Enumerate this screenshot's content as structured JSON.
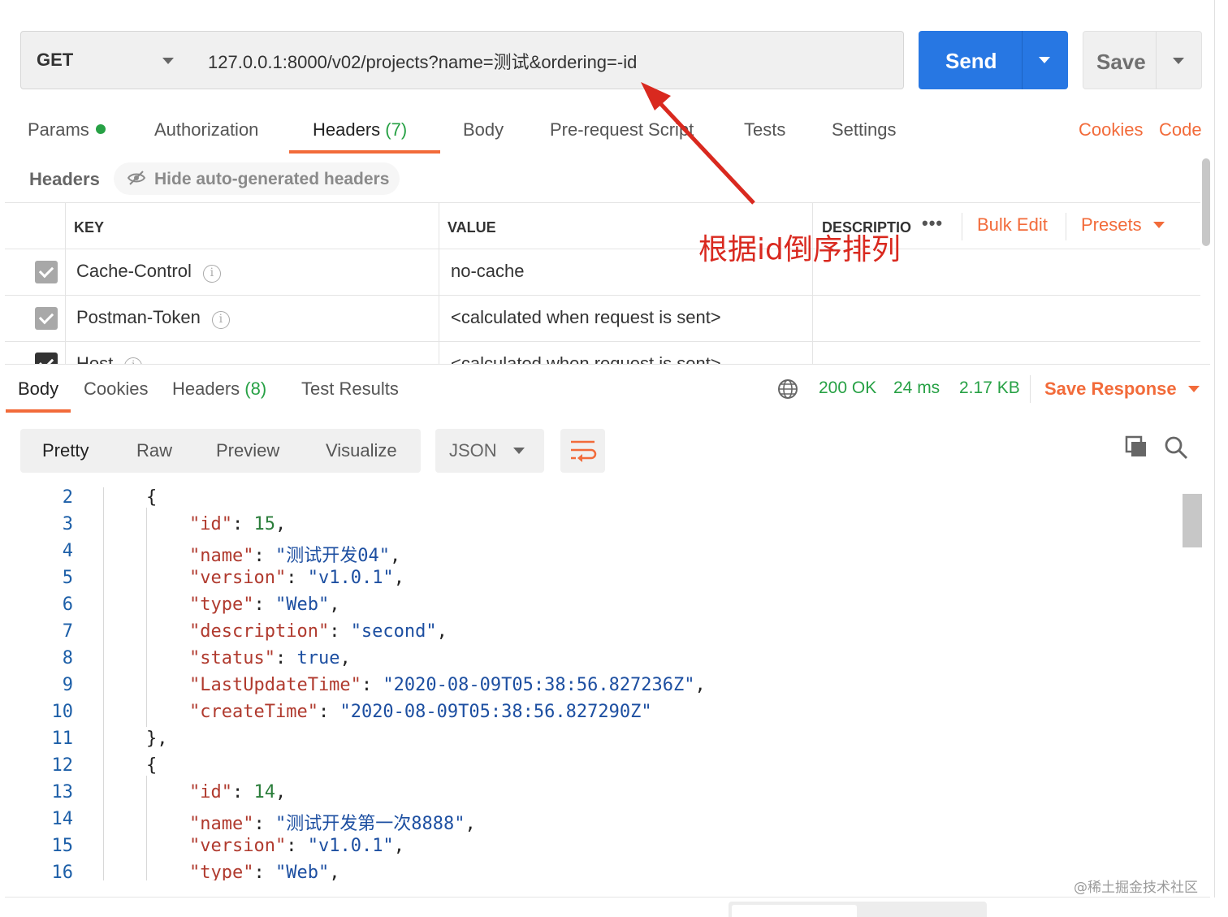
{
  "request": {
    "method": "GET",
    "url": "127.0.0.1:8000/v02/projects?name=测试&ordering=-id",
    "send_label": "Send",
    "save_label": "Save"
  },
  "request_tabs": [
    {
      "label": "Params"
    },
    {
      "label": "Authorization"
    },
    {
      "label": "Headers",
      "count": "(7)"
    },
    {
      "label": "Body"
    },
    {
      "label": "Pre-request Script"
    },
    {
      "label": "Tests"
    },
    {
      "label": "Settings"
    }
  ],
  "links": {
    "cookies": "Cookies",
    "code": "Code"
  },
  "headers_section": {
    "label": "Headers",
    "hide_auto": "Hide auto-generated headers"
  },
  "headers_table": {
    "columns": {
      "key": "KEY",
      "value": "VALUE",
      "description": "DESCRIPTIO"
    },
    "more": "•••",
    "bulk_edit": "Bulk Edit",
    "presets": "Presets",
    "rows": [
      {
        "key": "Cache-Control",
        "value": "no-cache"
      },
      {
        "key": "Postman-Token",
        "value": "<calculated when request is sent>"
      },
      {
        "key": "Host",
        "value": "<calculated when request is sent>"
      }
    ]
  },
  "annotation": {
    "text": "根据id倒序排列",
    "color": "#d9291f"
  },
  "response_tabs": [
    {
      "label": "Body"
    },
    {
      "label": "Cookies"
    },
    {
      "label": "Headers",
      "count": "(8)"
    },
    {
      "label": "Test Results"
    }
  ],
  "response_status": {
    "status": "200 OK",
    "time": "24 ms",
    "size": "2.17 KB",
    "save_response": "Save Response"
  },
  "view_modes": [
    "Pretty",
    "Raw",
    "Preview",
    "Visualize"
  ],
  "format": "JSON",
  "code_lines": [
    {
      "n": "2"
    },
    {
      "n": "3"
    },
    {
      "n": "4"
    },
    {
      "n": "5"
    },
    {
      "n": "6"
    },
    {
      "n": "7"
    },
    {
      "n": "8"
    },
    {
      "n": "9"
    },
    {
      "n": "10"
    },
    {
      "n": "11"
    },
    {
      "n": "12"
    },
    {
      "n": "13"
    },
    {
      "n": "14"
    },
    {
      "n": "15"
    },
    {
      "n": "16"
    }
  ],
  "json_text": {
    "open": "{",
    "close": "},",
    "k_id": "\"id\"",
    "k_name": "\"name\"",
    "k_version": "\"version\"",
    "k_type": "\"type\"",
    "k_description": "\"description\"",
    "k_status": "\"status\"",
    "k_last": "\"LastUpdateTime\"",
    "k_create": "\"createTime\"",
    "v_id1": "15",
    "v_name1": "\"测试开发04\"",
    "v_version1": "\"v1.0.1\"",
    "v_type1": "\"Web\"",
    "v_desc1": "\"second\"",
    "v_status1": "true",
    "v_last1": "\"2020-08-09T05:38:56.827236Z\"",
    "v_create1": "\"2020-08-09T05:38:56.827290Z\"",
    "v_id2": "14",
    "v_name2": "\"测试开发第一次8888\"",
    "v_version2": "\"v1.0.1\"",
    "v_type2": "\"Web\""
  },
  "watermark": "@稀土掘金技术社区",
  "colors": {
    "accent": "#f26b3a",
    "send": "#2777e3",
    "success": "#27a145"
  }
}
